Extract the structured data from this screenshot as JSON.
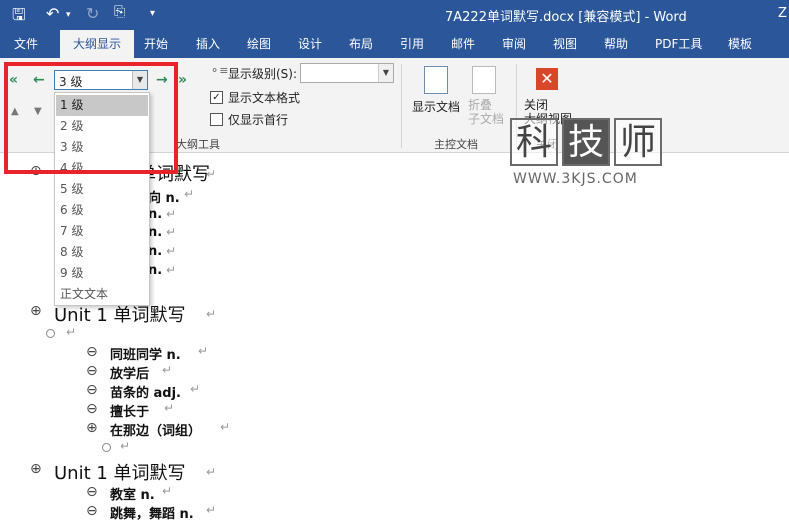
{
  "window": {
    "doc_title": "7A222单词默写.docx [兼容模式] - Word",
    "user_initial": "Z"
  },
  "tabs": [
    "文件",
    "大纲显示",
    "开始",
    "插入",
    "绘图",
    "设计",
    "布局",
    "引用",
    "邮件",
    "审阅",
    "视图",
    "帮助",
    "PDF工具",
    "模板"
  ],
  "ribbon": {
    "level_value": "3 级",
    "show_level_label": "显示级别(S):",
    "show_text_format": "显示文本格式",
    "show_first_line_only": "仅显示首行",
    "outline_tools_group": "大纲工具",
    "show_document": "显示文档",
    "collapse_subdocs": "折叠\n子文档",
    "master_doc_group": "主控文档",
    "close_outline_view": "关闭\n大纲视图",
    "close_group": "关闭"
  },
  "dropdown": {
    "items": [
      "1 级",
      "2 级",
      "3 级",
      "4 级",
      "5 级",
      "6 级",
      "7 级",
      "8 级",
      "9 级",
      "正文文本"
    ],
    "selected_index": 0
  },
  "watermark": {
    "chars": [
      "科",
      "技",
      "师"
    ],
    "url": "WWW.3KJS.COM"
  },
  "document": {
    "heading1": "Unit 1 单词默写",
    "partial_items": [
      "向 n.",
      "n.",
      "n.",
      "n.",
      "n."
    ],
    "section2": [
      "同班同学 n.",
      "放学后",
      "苗条的 adj.",
      "擅长于",
      "在那边（词组）"
    ],
    "section3": [
      "教室 n.",
      "跳舞，舞蹈 n."
    ],
    "para_mark": "↵"
  },
  "colors": {
    "brand": "#2b579a",
    "highlight_red": "#e8232a"
  }
}
